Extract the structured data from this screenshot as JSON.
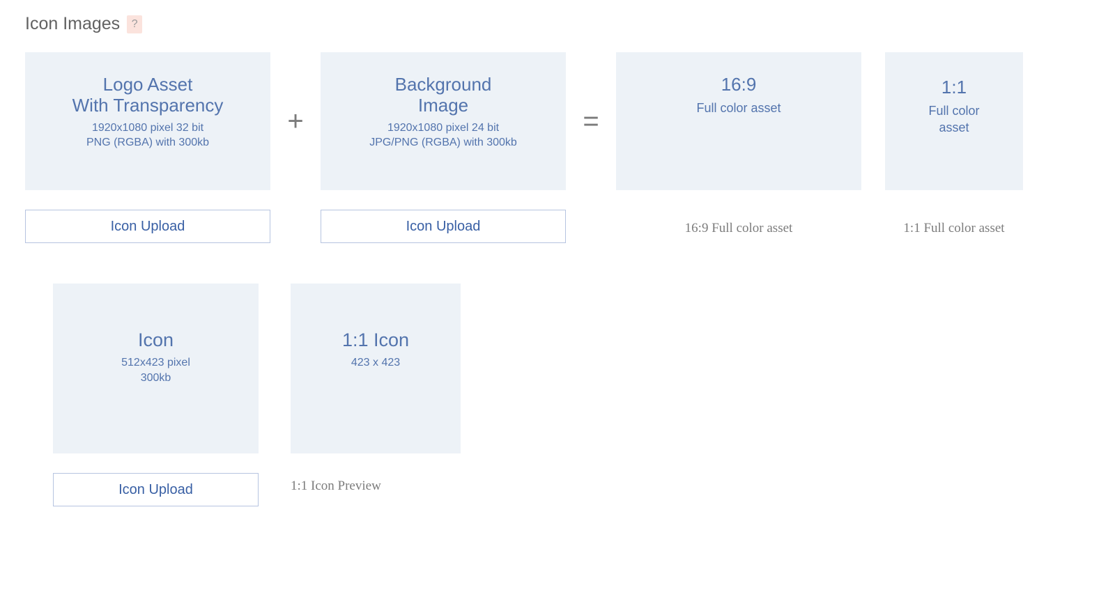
{
  "section": {
    "title": "Icon Images",
    "help_glyph": "?"
  },
  "operators": {
    "plus": "+",
    "equals": "="
  },
  "row1": {
    "logo": {
      "title_l1": "Logo Asset",
      "title_l2": "With Transparency",
      "spec_l1": "1920x1080 pixel 32 bit",
      "spec_l2": "PNG (RGBA) with 300kb",
      "upload_label": "Icon Upload"
    },
    "background": {
      "title_l1": "Background",
      "title_l2": "Image",
      "spec_l1": "1920x1080 pixel 24 bit",
      "spec_l2": "JPG/PNG (RGBA) with 300kb",
      "upload_label": "Icon Upload"
    },
    "result16x9": {
      "title": "16:9",
      "subtitle": "Full color asset",
      "caption": "16:9 Full color asset"
    },
    "result1x1": {
      "title": "1:1",
      "subtitle_l1": "Full color",
      "subtitle_l2": "asset",
      "caption": "1:1 Full color asset"
    }
  },
  "row2": {
    "icon": {
      "title": "Icon",
      "spec_l1": "512x423 pixel",
      "spec_l2": "300kb",
      "upload_label": "Icon Upload"
    },
    "preview": {
      "title": "1:1 Icon",
      "spec": "423 x 423",
      "caption": "1:1 Icon Preview"
    }
  }
}
